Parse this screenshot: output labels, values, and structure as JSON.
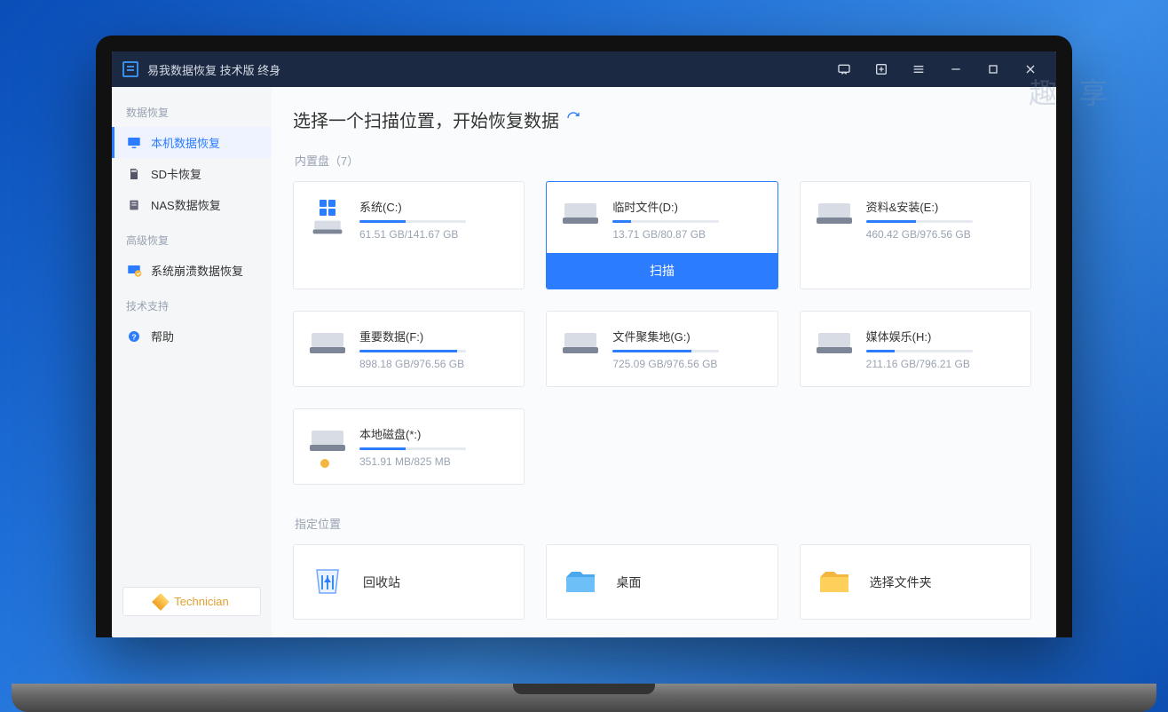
{
  "titlebar": {
    "app_title": "易我数据恢复 技术版 终身"
  },
  "sidebar": {
    "sections": {
      "data_recovery": "数据恢复",
      "advanced_recovery": "高级恢复",
      "tech_support": "技术支持"
    },
    "items": {
      "local": "本机数据恢复",
      "sd": "SD卡恢复",
      "nas": "NAS数据恢复",
      "crash": "系统崩溃数据恢复",
      "help": "帮助"
    },
    "technician_label": "Technician"
  },
  "main": {
    "title": "选择一个扫描位置，开始恢复数据",
    "internal_drives_label": "内置盘（7）",
    "specified_location_label": "指定位置",
    "scan_button": "扫描",
    "drives": [
      {
        "name": "系统(C:)",
        "used": "61.51 GB",
        "total": "141.67 GB",
        "pct": 43,
        "system": true
      },
      {
        "name": "临时文件(D:)",
        "used": "13.71 GB",
        "total": "80.87 GB",
        "pct": 17,
        "selected": true
      },
      {
        "name": "资料&安装(E:)",
        "used": "460.42 GB",
        "total": "976.56 GB",
        "pct": 47
      },
      {
        "name": "重要数据(F:)",
        "used": "898.18 GB",
        "total": "976.56 GB",
        "pct": 92
      },
      {
        "name": "文件聚集地(G:)",
        "used": "725.09 GB",
        "total": "976.56 GB",
        "pct": 74
      },
      {
        "name": "媒体娱乐(H:)",
        "used": "211.16 GB",
        "total": "796.21 GB",
        "pct": 27
      },
      {
        "name": "本地磁盘(*:)",
        "used": "351.91 MB",
        "total": "825 MB",
        "pct": 43,
        "warn": true
      }
    ],
    "locations": [
      {
        "key": "recycle",
        "label": "回收站"
      },
      {
        "key": "desktop",
        "label": "桌面"
      },
      {
        "key": "folder",
        "label": "选择文件夹"
      }
    ]
  }
}
